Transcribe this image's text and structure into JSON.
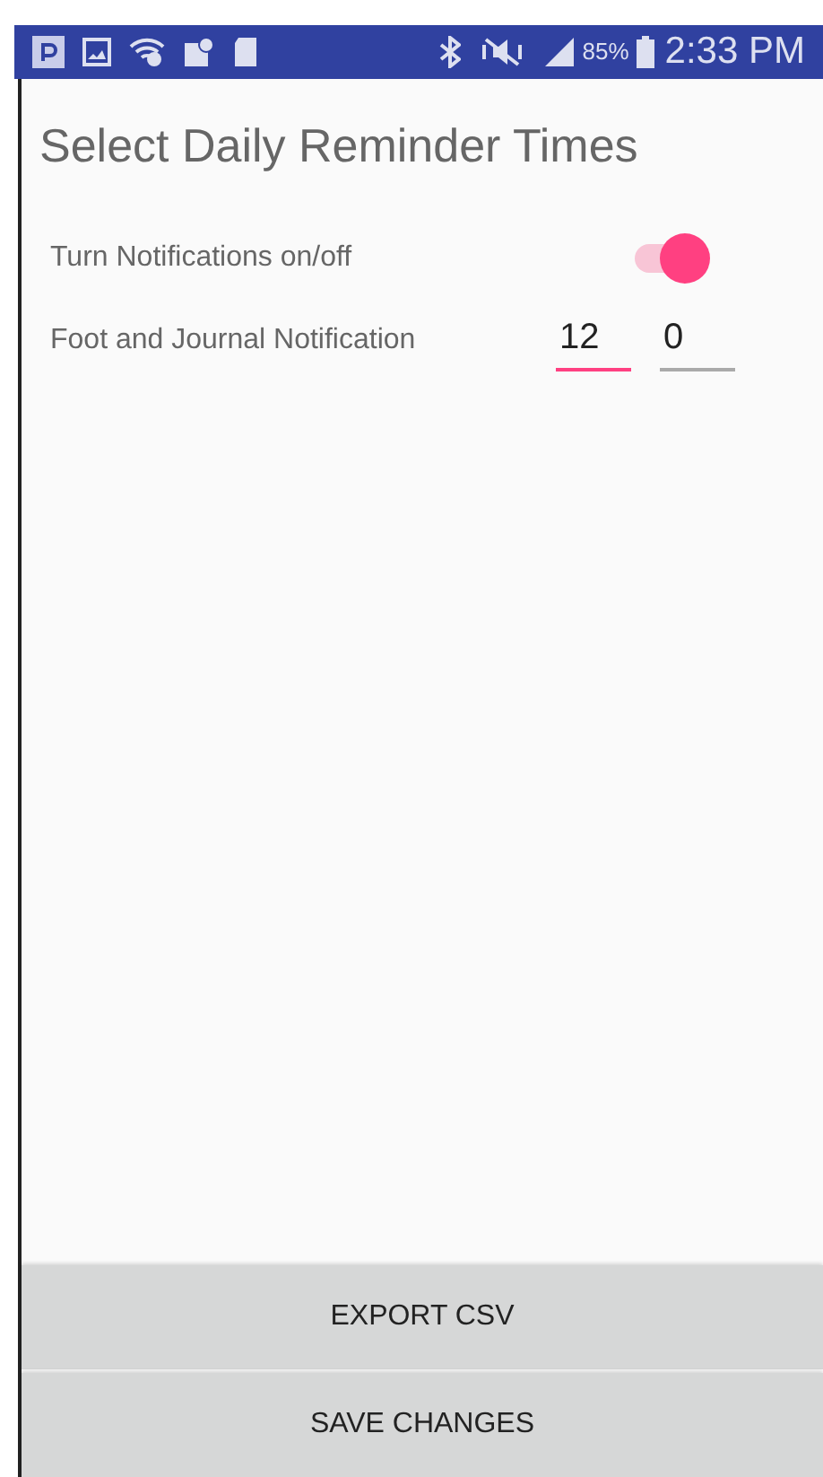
{
  "status_bar": {
    "battery": "85%",
    "time": "2:33 PM"
  },
  "title": "Select Daily Reminder Times",
  "notifications_toggle": {
    "label": "Turn Notifications on/off",
    "on": true
  },
  "reminder": {
    "label": "Foot and Journal Notification",
    "fields": [
      {
        "value": "12",
        "focused": true
      },
      {
        "value": "0",
        "focused": false
      }
    ]
  },
  "buttons": [
    "EXPORT CSV",
    "SAVE CHANGES"
  ]
}
